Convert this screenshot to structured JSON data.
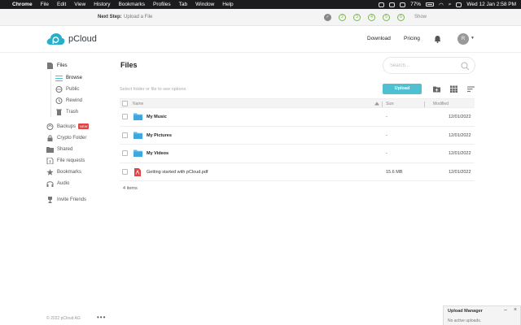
{
  "menubar": {
    "items": [
      "Chrome",
      "File",
      "Edit",
      "View",
      "History",
      "Bookmarks",
      "Profiles",
      "Tab",
      "Window",
      "Help"
    ],
    "battery": "77%",
    "datetime": "Wed 12 Jan  2:58 PM"
  },
  "next_step": {
    "label": "Next Step:",
    "task": "Upload a File",
    "steps": [
      "✓",
      "2",
      "3",
      "4",
      "5",
      "6"
    ],
    "show_label": "Show"
  },
  "header": {
    "brand": "pCloud",
    "download": "Download",
    "pricing": "Pricing",
    "avatar_initial": "R"
  },
  "sidebar": {
    "files": "Files",
    "browse": "Browse",
    "public": "Public",
    "rewind": "Rewind",
    "trash": "Trash",
    "backups": "Backups",
    "new_badge": "NEW",
    "crypto_folder": "Crypto Folder",
    "shared": "Shared",
    "file_requests": "File requests",
    "bookmarks": "Bookmarks",
    "audio": "Audio",
    "invite_friends": "Invite Friends",
    "copyright": "© 2022 pCloud AG",
    "more": "•••"
  },
  "main": {
    "title": "Files",
    "search_placeholder": "Search...",
    "hint": "Select folder or file to see options",
    "upload": "Upload",
    "columns": {
      "name": "Name",
      "size": "Size",
      "modified": "Modified"
    },
    "rows": [
      {
        "name": "My Music",
        "size": "-",
        "modified": "12/01/2022",
        "kind": "folder"
      },
      {
        "name": "My Pictures",
        "size": "-",
        "modified": "12/01/2022",
        "kind": "folder"
      },
      {
        "name": "My Videos",
        "size": "-",
        "modified": "12/01/2022",
        "kind": "folder"
      },
      {
        "name": "Getting started with pCloud.pdf",
        "size": "15.6 MB",
        "modified": "12/01/2022",
        "kind": "pdf"
      }
    ],
    "items_count": "4 items"
  },
  "upload_manager": {
    "title": "Upload Manager",
    "status": "No active uploads.",
    "minimize": "–",
    "close": "×"
  },
  "colors": {
    "accent": "#4ec0d0",
    "folder": "#5bb8e8",
    "pdf": "#e04646",
    "step_green": "#7cb84e",
    "menubar": "#1c1c1e"
  }
}
